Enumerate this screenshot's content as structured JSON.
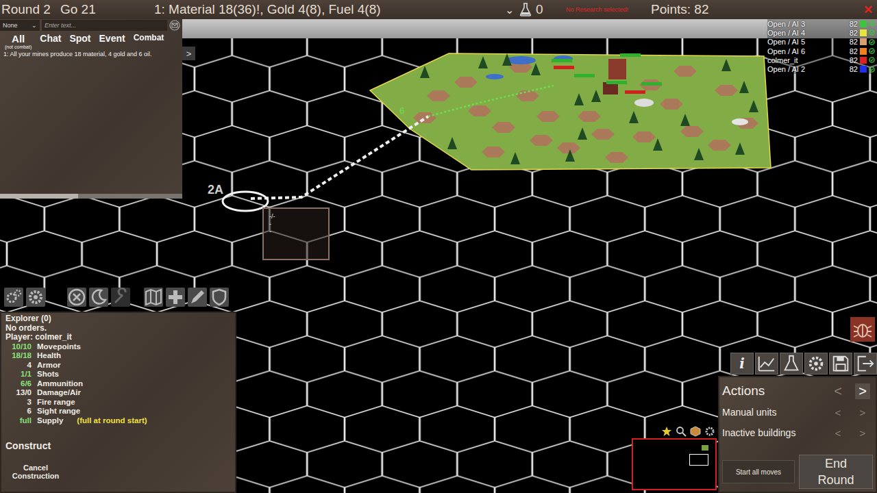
{
  "top_bar": {
    "round": "Round 2",
    "go": "Go 21",
    "resources": "1: Material 18(36)!, Gold 4(8), Fuel 4(8)",
    "menu_arrow": "⌄",
    "research_count": "0",
    "research_warning": "No Research selected!",
    "points": "Points: 82",
    "close": "✕"
  },
  "message_panel": {
    "filter": "None",
    "filter_arrow": "⌄",
    "input_placeholder": "Enter text...",
    "tabs": [
      {
        "label": "All",
        "sub": "(not combat)",
        "selected": true
      },
      {
        "label": "Chat",
        "selected": false
      },
      {
        "label": "Spot",
        "selected": false
      },
      {
        "label": "Event",
        "selected": false
      },
      {
        "label": "Combat",
        "selected": false
      }
    ],
    "messages": [
      "1: All your mines produce 18 material, 4 gold and 6 oil."
    ],
    "scroll_level": 0.43,
    "collapse": ">"
  },
  "players": [
    {
      "name": "Open / AI 3",
      "points": "82",
      "color": "#3cc43c"
    },
    {
      "name": "Open / AI 4",
      "points": "82",
      "color": "#e6e63a"
    },
    {
      "name": "Open / AI 5",
      "points": "82",
      "color": "#d8a070"
    },
    {
      "name": "Open / AI 6",
      "points": "82",
      "color": "#f0801e"
    },
    {
      "name": "colmer_it",
      "points": "82",
      "color": "#e02020"
    },
    {
      "name": "Open / AI 2",
      "points": "82",
      "color": "#2030e8"
    }
  ],
  "map": {
    "unit_label": "2A",
    "path_cost": "6",
    "tooltip": [
      "-/-",
      "-",
      "-"
    ]
  },
  "unit": {
    "name": "Explorer (0)",
    "orders": "No orders.",
    "player": "Player: colmer_it",
    "stats": [
      {
        "value": "10/10",
        "label": "Movepoints",
        "full": true
      },
      {
        "value": "18/18",
        "label": "Health",
        "full": true
      },
      {
        "value": "4",
        "label": "Armor",
        "full": false
      },
      {
        "value": "1/1",
        "label": "Shots",
        "full": true
      },
      {
        "value": "6/6",
        "label": "Ammunition",
        "full": true
      },
      {
        "value": "13/0",
        "label": "Damage/Air",
        "full": false
      },
      {
        "value": "3",
        "label": "Fire range",
        "full": false
      },
      {
        "value": "6",
        "label": "Sight range",
        "full": false
      }
    ],
    "supply": {
      "value": "full",
      "label": "Supply",
      "note": "(full at round start)"
    },
    "construct": "Construct",
    "cancel": "Cancel Construction"
  },
  "side_buttons": {
    "info": "i"
  },
  "actions": {
    "rows": [
      {
        "label": "Actions",
        "kind": "header",
        "prev_enabled": false,
        "next_enabled": true
      },
      {
        "label": "Manual units",
        "kind": "row",
        "prev_enabled": false,
        "next_enabled": false
      },
      {
        "label": "Inactive buildings",
        "kind": "row",
        "prev_enabled": false,
        "next_enabled": false
      }
    ],
    "prev": "<",
    "next": ">",
    "start_all": "Start all moves",
    "end_round": "End Round"
  }
}
